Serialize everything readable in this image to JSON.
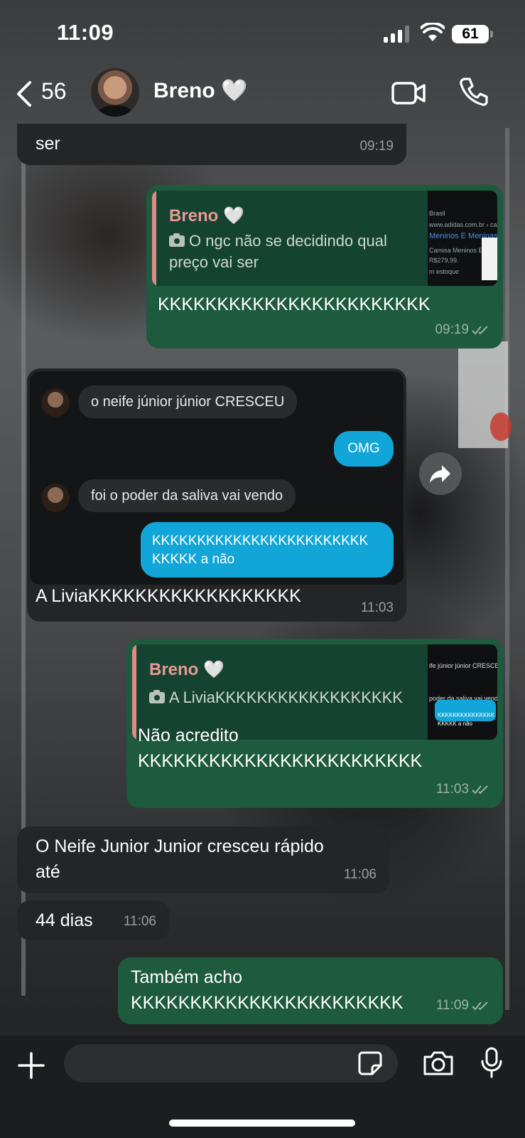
{
  "status": {
    "time": "11:09",
    "battery": "61"
  },
  "header": {
    "back_count": "56",
    "contact": "Breno 🤍"
  },
  "messages": {
    "m1": {
      "text": "ser",
      "time": "09:19"
    },
    "m2": {
      "quote_name": "Breno 🤍",
      "quote_text": "O ngc não se decidindo qual preço vai ser",
      "thumb_lines": [
        "Brasil",
        "www.adidas.com.br › camisa...",
        "Meninos E Meninas F.C",
        "Camisa Meninos E",
        "R$279,99.",
        "m estoque"
      ],
      "text": "KKKKKKKKKKKKKKKKKKKKKKK",
      "time": "09:19"
    },
    "m3": {
      "ig_in_1": "o neife júnior júnior CRESCEU",
      "ig_out_1": "OMG",
      "ig_in_2": "foi o poder da saliva vai vendo",
      "ig_out_2_line1": "KKKKKKKKKKKKKKKKKKKKKKKK",
      "ig_out_2_line2": "KKKKK a não",
      "caption": "A LiviaKKKKKKKKKKKKKKKKKK",
      "time": "11:03"
    },
    "m4": {
      "quote_name": "Breno 🤍",
      "quote_text": "A LiviaKKKKKKKKKKKKKKKKKK",
      "thumb_lines": [
        "ife júnior júnior CRESCEU",
        "poder da saliva vai vendo",
        "KKKKKKKKKKKKKKK",
        "KKKKK a não"
      ],
      "line1": "Não acredito",
      "line2": "KKKKKKKKKKKKKKKKKKKKKKKK",
      "time": "11:03"
    },
    "m5": {
      "line1": "O Neife Junior Junior cresceu rápido",
      "line2": "até",
      "time": "11:06"
    },
    "m6": {
      "text": "44 dias",
      "time": "11:06"
    },
    "m7": {
      "line1": "Também acho",
      "line2": "KKKKKKKKKKKKKKKKKKKKKKK",
      "time": "11:09"
    }
  },
  "colors": {
    "incoming": "#232526",
    "outgoing": "#1d5a3e",
    "quote_name": "#e79a95",
    "instagram_blue": "#12a6d8"
  },
  "icons": [
    "back-chevron",
    "video-camera",
    "phone",
    "forward-arrow",
    "plus",
    "sticker",
    "camera",
    "microphone",
    "camera-small",
    "double-check"
  ]
}
